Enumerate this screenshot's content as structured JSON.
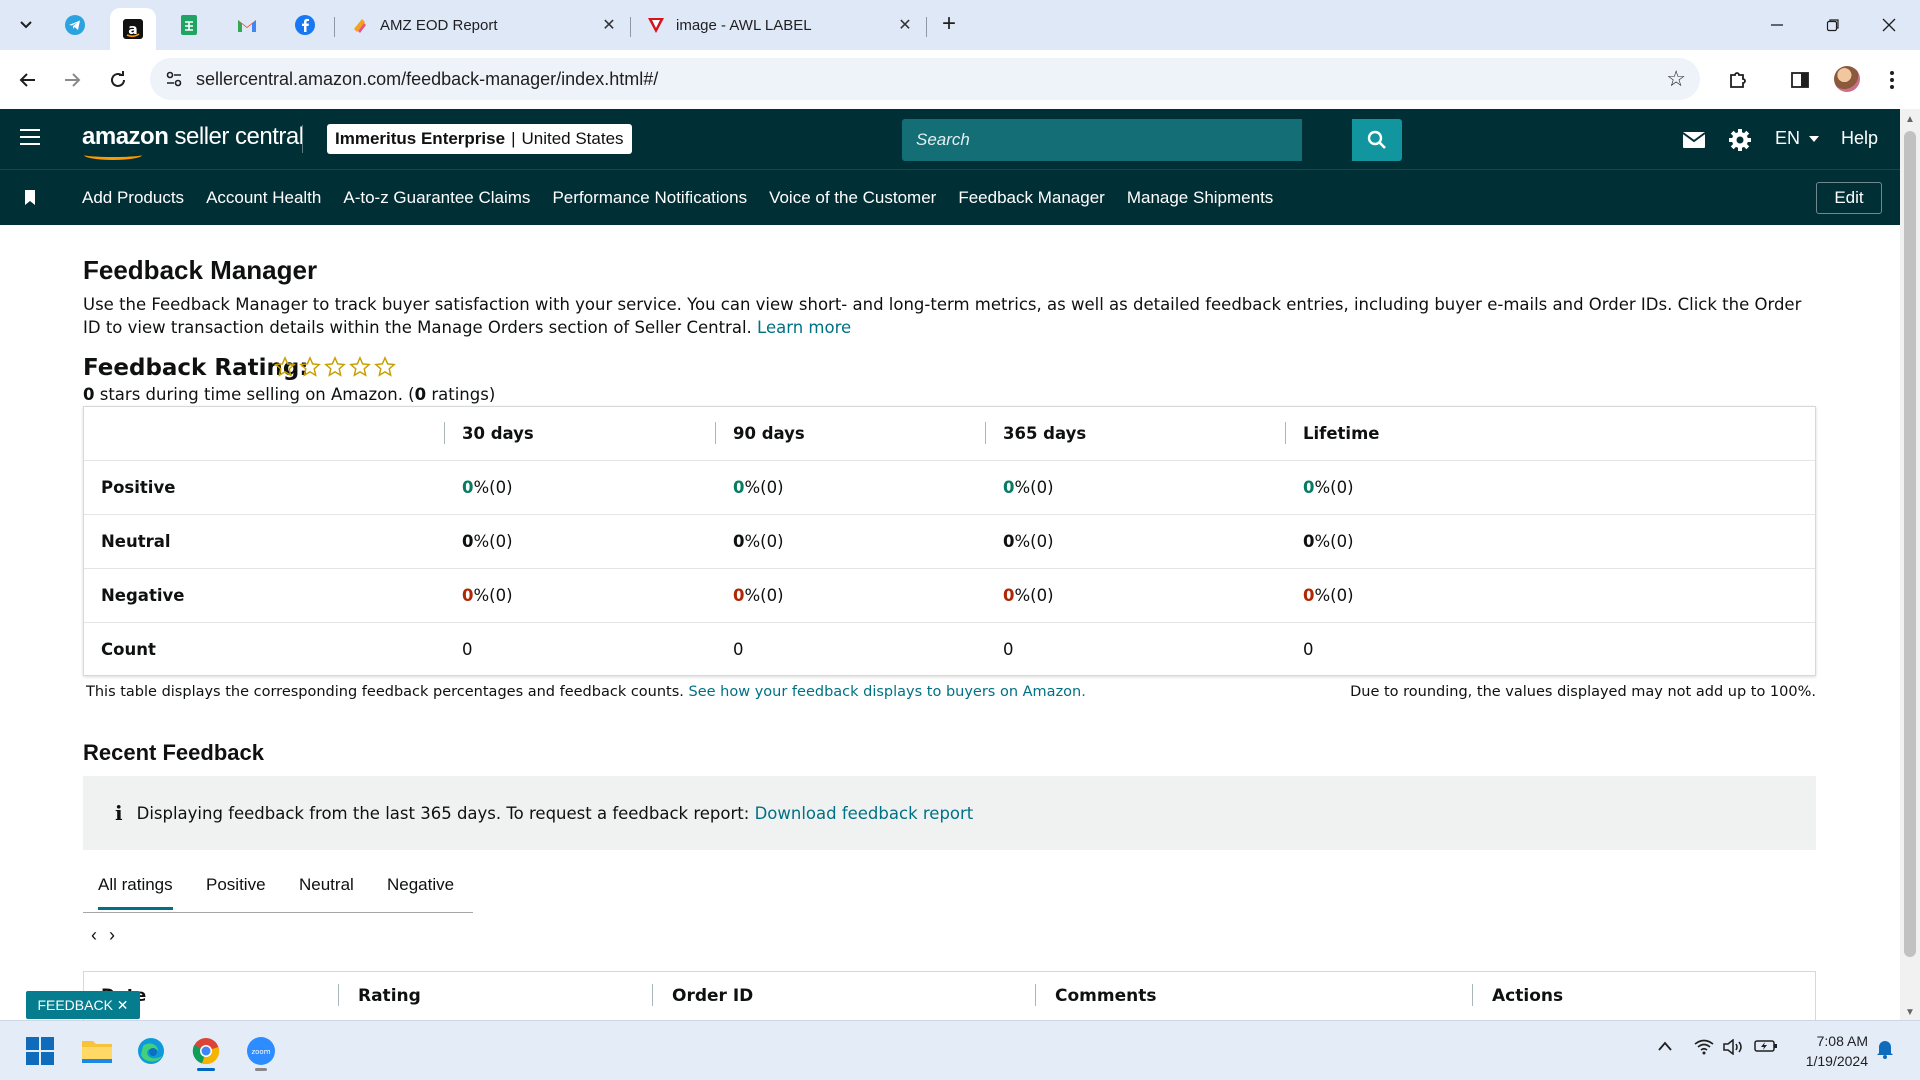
{
  "browser": {
    "tabs": [
      {
        "label": "AMZ EOD Report",
        "icon": "amz-eod-favicon"
      },
      {
        "label": "image - AWL LABEL",
        "icon": "awl-favicon"
      }
    ],
    "pinned_tabs": [
      "telegram-icon",
      "amazon-icon",
      "google-sheets-icon",
      "gmail-icon",
      "facebook-icon"
    ],
    "url": "sellercentral.amazon.com/feedback-manager/index.html#/"
  },
  "header": {
    "logo_text_bold": "amazon",
    "logo_text": " seller central",
    "account_name": "Immeritus Enterprise",
    "account_sep": "|",
    "account_region": "United States",
    "search_placeholder": "Search",
    "language": "EN",
    "help": "Help"
  },
  "subnav": {
    "items": [
      "Add Products",
      "Account Health",
      "A-to-z Guarantee Claims",
      "Performance Notifications",
      "Voice of the Customer",
      "Feedback Manager",
      "Manage Shipments"
    ],
    "edit": "Edit"
  },
  "page": {
    "title": "Feedback Manager",
    "intro": "Use the Feedback Manager to track buyer satisfaction with your service. You can view short- and long-term metrics, as well as detailed feedback entries, including buyer e-mails and Order IDs. Click the Order ID to view transaction details within the Manage Orders section of Seller Central.",
    "learn_more": "Learn more",
    "rating_title": "Feedback Rating:",
    "rating_stars": 0,
    "rating_sub_stars": "0",
    "rating_sub_mid": " stars during time selling on Amazon. (",
    "rating_sub_count": "0",
    "rating_sub_end": " ratings)"
  },
  "feedback_table": {
    "columns": [
      "30 days",
      "90 days",
      "365 days",
      "Lifetime"
    ],
    "rows": [
      {
        "label": "Positive",
        "kind": "pos",
        "cells": [
          {
            "n": "0",
            "s": " %(0)"
          },
          {
            "n": "0",
            "s": " %(0)"
          },
          {
            "n": "0",
            "s": " %(0)"
          },
          {
            "n": "0",
            "s": " %(0)"
          }
        ]
      },
      {
        "label": "Neutral",
        "kind": "neu",
        "cells": [
          {
            "n": "0",
            "s": " %(0)"
          },
          {
            "n": "0",
            "s": " %(0)"
          },
          {
            "n": "0",
            "s": " %(0)"
          },
          {
            "n": "0",
            "s": " %(0)"
          }
        ]
      },
      {
        "label": "Negative",
        "kind": "neg",
        "cells": [
          {
            "n": "0",
            "s": " %(0)"
          },
          {
            "n": "0",
            "s": " %(0)"
          },
          {
            "n": "0",
            "s": " %(0)"
          },
          {
            "n": "0",
            "s": " %(0)"
          }
        ]
      },
      {
        "label": "Count",
        "kind": "count",
        "cells": [
          {
            "n": "",
            "s": "0"
          },
          {
            "n": "",
            "s": "0"
          },
          {
            "n": "",
            "s": "0"
          },
          {
            "n": "",
            "s": "0"
          }
        ]
      }
    ],
    "note": "This table displays the corresponding feedback percentages and feedback counts.",
    "note_link": "See how your feedback displays to buyers on Amazon.",
    "note_right": "Due to rounding, the values displayed may not add up to 100%."
  },
  "recent": {
    "title": "Recent Feedback",
    "info_icon": "i",
    "info_text": "Displaying feedback from the last 365 days. To request a feedback report:",
    "info_link": "Download feedback report",
    "tabs": [
      "All ratings",
      "Positive",
      "Neutral",
      "Negative"
    ],
    "pager_prev": "‹",
    "pager_next": "›",
    "columns": [
      "Date",
      "Rating",
      "Order ID",
      "Comments",
      "Actions"
    ],
    "feedback_chip": "FEEDBACK ✕"
  },
  "taskbar": {
    "time": "7:08 AM",
    "date": "1/19/2024",
    "apps": [
      "start-icon",
      "file-explorer-icon",
      "edge-icon",
      "chrome-icon",
      "zoom-icon"
    ]
  },
  "colors": {
    "header_bg": "#002f36",
    "search_btn": "#1196a0",
    "link": "#007185",
    "positive": "#067d62",
    "negative": "#b12704",
    "star": "#c7a000"
  }
}
